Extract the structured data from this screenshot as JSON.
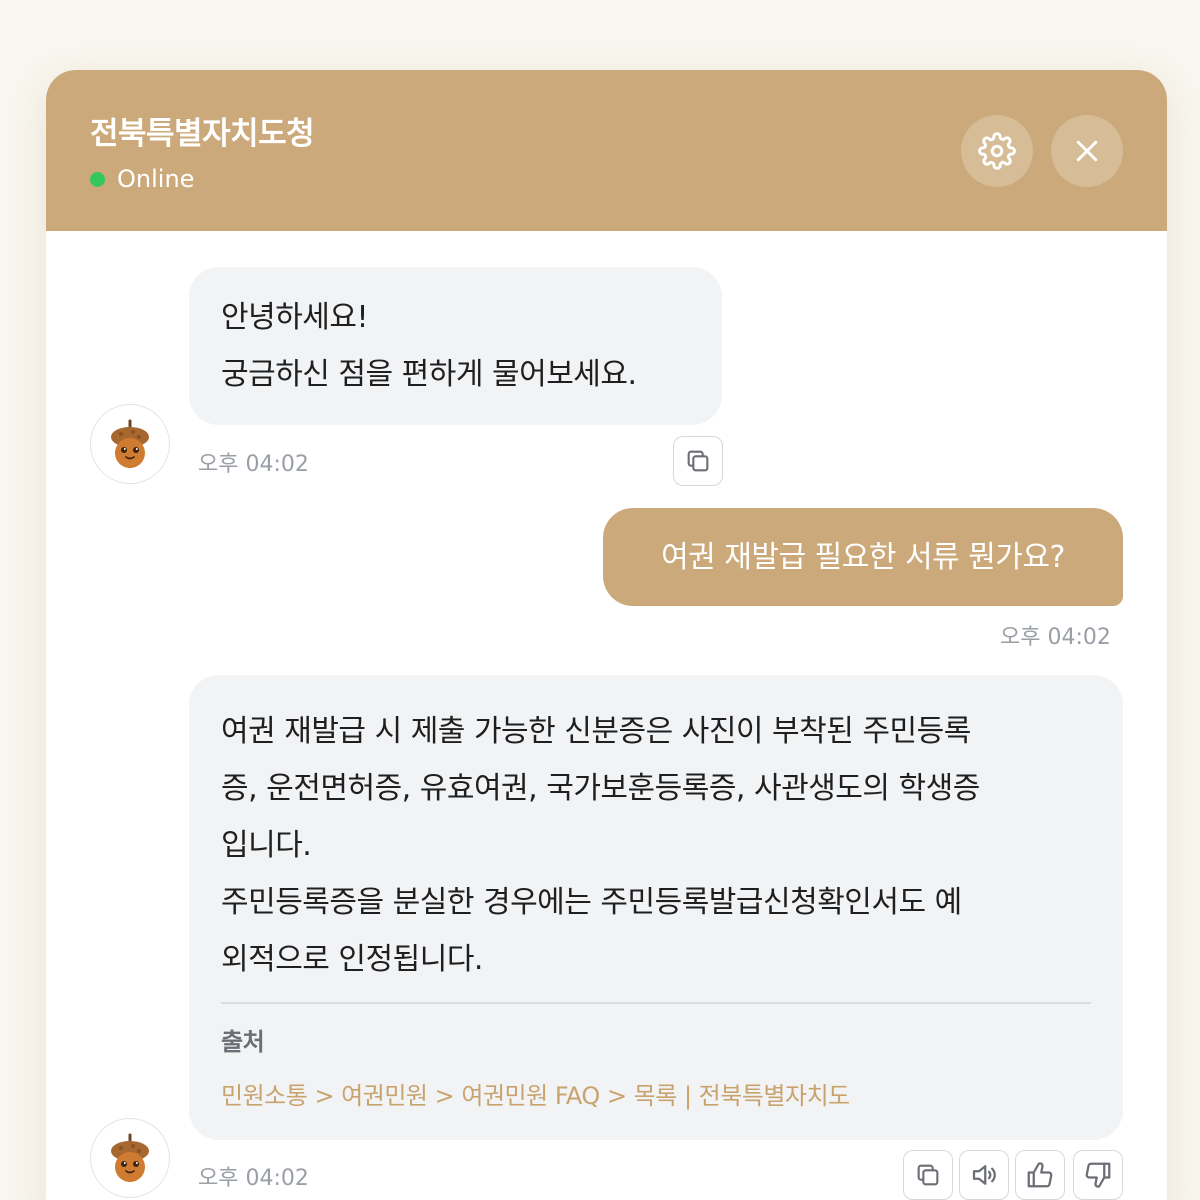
{
  "header": {
    "title": "전북특별자치도청",
    "status": "Online",
    "settings_icon": "gear-icon",
    "close_icon": "close-icon"
  },
  "colors": {
    "accent": "#cba97a",
    "online": "#34c759",
    "bot_bubble": "#f2f3f5",
    "link": "#c9a36e"
  },
  "messages": {
    "greeting": {
      "lines": [
        "안녕하세요!",
        "궁금하신 점을 편하게 물어보세요."
      ],
      "time": "오후 04:02"
    },
    "user": {
      "text": "여권 재발급 필요한 서류 뭔가요?",
      "time": "오후 04:02"
    },
    "answer": {
      "lines": [
        "여권 재발급 시 제출 가능한 신분증은 사진이 부착된 주민등록",
        "증, 운전면허증, 유효여권, 국가보훈등록증, 사관생도의 학생증",
        "입니다.",
        "주민등록증을 분실한 경우에는 주민등록발급신청확인서도 예",
        "외적으로 인정됩니다."
      ],
      "source_label": "출처",
      "source_link": "민원소통 > 여권민원 > 여권민원 FAQ > 목록 | 전북특별자치도",
      "time": "오후 04:02"
    }
  },
  "bot_avatar": "acorn-mascot",
  "actions": [
    "copy-icon",
    "speaker-icon",
    "thumbs-up-icon",
    "thumbs-down-icon"
  ]
}
